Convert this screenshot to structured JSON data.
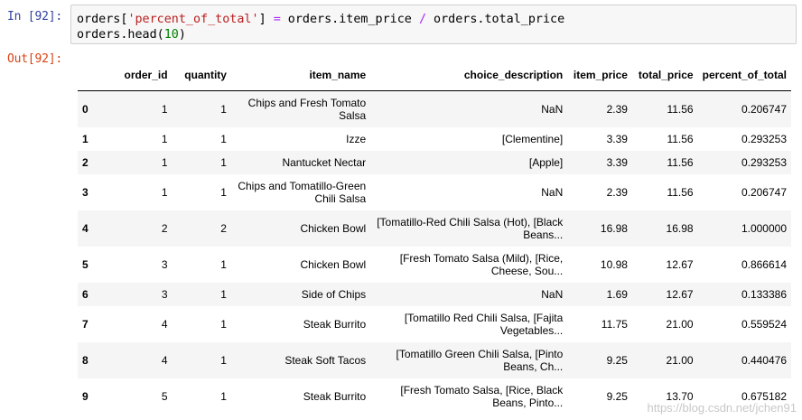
{
  "input_prompt": "In [92]:",
  "output_prompt": "Out[92]:",
  "code": {
    "line1_var": "orders[",
    "line1_str": "'percent_of_total'",
    "line1_mid": "] ",
    "line1_eq": "=",
    "line1_rhs1": " orders.item_price ",
    "line1_div": "/",
    "line1_rhs2": " orders.total_price",
    "line2_call": "orders.head(",
    "line2_num": "10",
    "line2_end": ")"
  },
  "table": {
    "columns": [
      "",
      "order_id",
      "quantity",
      "item_name",
      "choice_description",
      "item_price",
      "total_price",
      "percent_of_total"
    ],
    "rows": [
      {
        "index": "0",
        "order_id": "1",
        "quantity": "1",
        "item_name": "Chips and Fresh Tomato Salsa",
        "choice_description": "NaN",
        "item_price": "2.39",
        "total_price": "11.56",
        "percent_of_total": "0.206747"
      },
      {
        "index": "1",
        "order_id": "1",
        "quantity": "1",
        "item_name": "Izze",
        "choice_description": "[Clementine]",
        "item_price": "3.39",
        "total_price": "11.56",
        "percent_of_total": "0.293253"
      },
      {
        "index": "2",
        "order_id": "1",
        "quantity": "1",
        "item_name": "Nantucket Nectar",
        "choice_description": "[Apple]",
        "item_price": "3.39",
        "total_price": "11.56",
        "percent_of_total": "0.293253"
      },
      {
        "index": "3",
        "order_id": "1",
        "quantity": "1",
        "item_name": "Chips and Tomatillo-Green Chili Salsa",
        "choice_description": "NaN",
        "item_price": "2.39",
        "total_price": "11.56",
        "percent_of_total": "0.206747"
      },
      {
        "index": "4",
        "order_id": "2",
        "quantity": "2",
        "item_name": "Chicken Bowl",
        "choice_description": "[Tomatillo-Red Chili Salsa (Hot), [Black Beans...",
        "item_price": "16.98",
        "total_price": "16.98",
        "percent_of_total": "1.000000"
      },
      {
        "index": "5",
        "order_id": "3",
        "quantity": "1",
        "item_name": "Chicken Bowl",
        "choice_description": "[Fresh Tomato Salsa (Mild), [Rice, Cheese, Sou...",
        "item_price": "10.98",
        "total_price": "12.67",
        "percent_of_total": "0.866614"
      },
      {
        "index": "6",
        "order_id": "3",
        "quantity": "1",
        "item_name": "Side of Chips",
        "choice_description": "NaN",
        "item_price": "1.69",
        "total_price": "12.67",
        "percent_of_total": "0.133386"
      },
      {
        "index": "7",
        "order_id": "4",
        "quantity": "1",
        "item_name": "Steak Burrito",
        "choice_description": "[Tomatillo Red Chili Salsa, [Fajita Vegetables...",
        "item_price": "11.75",
        "total_price": "21.00",
        "percent_of_total": "0.559524"
      },
      {
        "index": "8",
        "order_id": "4",
        "quantity": "1",
        "item_name": "Steak Soft Tacos",
        "choice_description": "[Tomatillo Green Chili Salsa, [Pinto Beans, Ch...",
        "item_price": "9.25",
        "total_price": "21.00",
        "percent_of_total": "0.440476"
      },
      {
        "index": "9",
        "order_id": "5",
        "quantity": "1",
        "item_name": "Steak Burrito",
        "choice_description": "[Fresh Tomato Salsa, [Rice, Black Beans, Pinto...",
        "item_price": "9.25",
        "total_price": "13.70",
        "percent_of_total": "0.675182"
      }
    ]
  },
  "watermark": "https://blog.csdn.net/jchen91"
}
